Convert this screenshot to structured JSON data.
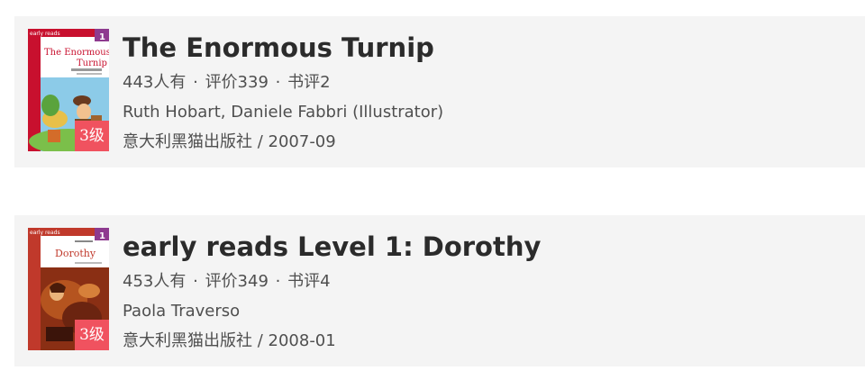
{
  "books": [
    {
      "cover_brand": "early reads",
      "cover_level_num": "1",
      "cover_title_line1": "The Enormous",
      "cover_title_line2": "Turnip",
      "level_badge": "3级",
      "title": "The Enormous Turnip",
      "owners": "443人有",
      "rating": "评价339",
      "reviews": "书评2",
      "authors": "Ruth Hobart, Daniele Fabbri (Illustrator)",
      "publisher_date": "意大利黑猫出版社 / 2007-09",
      "cover_color": "#c8102e"
    },
    {
      "cover_brand": "early reads",
      "cover_level_num": "1",
      "cover_title_line1": "Dorothy",
      "level_badge": "3级",
      "title": "early reads Level 1: Dorothy",
      "owners": "453人有",
      "rating": "评价349",
      "reviews": "书评4",
      "authors": "Paola Traverso",
      "publisher_date": "意大利黑猫出版社 / 2008-01",
      "cover_color": "#c0392b"
    }
  ],
  "separator": "·"
}
